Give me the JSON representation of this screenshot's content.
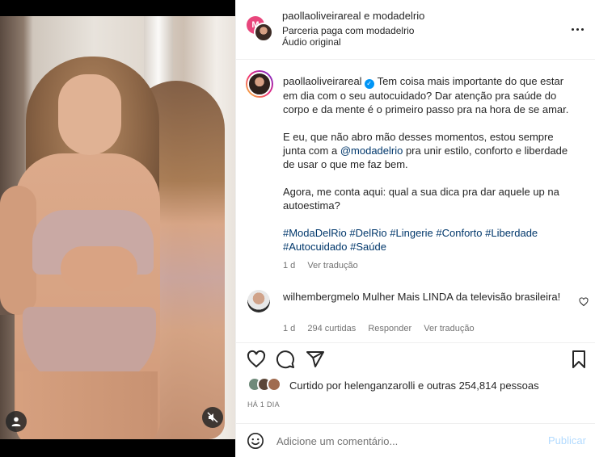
{
  "header": {
    "accounts_line": "paollaoliveirareal e modadelrio",
    "partnership": "Parceria paga com modadelrio",
    "audio": "Áudio original",
    "brand_avatar_letter": "M",
    "more_icon": "more-horizontal-icon"
  },
  "caption": {
    "username": "paollaoliveirareal",
    "text_p1": "Tem coisa mais importante do que estar em dia com o seu autocuidado? Dar atenção pra saúde do corpo e da mente é o primeiro passo pra na hora de se amar.",
    "text_p2_before": "E eu, que não abro mão desses momentos, estou sempre junta com a ",
    "mention": "@modadelrio",
    "text_p2_after": " pra unir estilo, conforto e liberdade de usar o que me faz bem.",
    "text_p3": "Agora, me conta aqui: qual a sua dica pra dar aquele up na autoestima?",
    "hashtags": [
      "#ModaDelRio",
      "#DelRio",
      "#Lingerie",
      "#Conforto",
      "#Liberdade",
      "#Autocuidado",
      "#Saúde"
    ],
    "age": "1 d",
    "translate": "Ver tradução"
  },
  "comment": {
    "username": "wilhembergmelo",
    "text": "Mulher Mais LINDA da televisão brasileira!",
    "age": "1 d",
    "likes": "294 curtidas",
    "reply": "Responder",
    "translate": "Ver tradução"
  },
  "likes": {
    "text": "Curtido por helenganzarolli e outras 254,814 pessoas",
    "time_ago": "HÁ 1 DIA"
  },
  "comment_bar": {
    "placeholder": "Adicione um comentário...",
    "post_label": "Publicar"
  },
  "colors": {
    "link": "#00376b",
    "verified": "#0095f6",
    "post_disabled": "#b3dbff",
    "meta": "#737373"
  }
}
